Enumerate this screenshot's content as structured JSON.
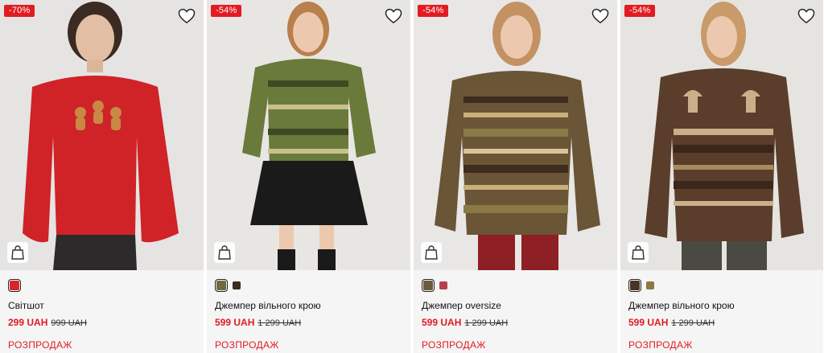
{
  "products": [
    {
      "badge": "-70%",
      "name": "Світшот",
      "price": "299 UAH",
      "old_price": "999 UAH",
      "label": "РОЗПРОДАЖ",
      "colors": [
        "#d8262d"
      ],
      "theme": {
        "bg": "#e6e4e2",
        "garment": "#cf2328",
        "garment_dark": "#a8181d",
        "hair": "#3b2b22",
        "pants": "#2c2a2b"
      }
    },
    {
      "badge": "-54%",
      "name": "Джемпер вільного крою",
      "price": "599 UAH",
      "old_price": "1 299 UAH",
      "label": "РОЗПРОДАЖ",
      "colors": [
        "#6e6a3c",
        "#3b2b22"
      ],
      "theme": {
        "bg": "#e8e6e3",
        "garment": "#6a7a3a",
        "garment_dark": "#3f4a22",
        "hair": "#b97f4c",
        "pants": "#1a1a1a"
      }
    },
    {
      "badge": "-54%",
      "name": "Джемпер oversize",
      "price": "599 UAH",
      "old_price": "1 299 UAH",
      "label": "РОЗПРОДАЖ",
      "colors": [
        "#6b5a3c",
        "#b9404a"
      ],
      "theme": {
        "bg": "#e9e7e5",
        "garment": "#6b5537",
        "garment_dark": "#3e2c1d",
        "hair": "#c49262",
        "pants": "#8e1f24"
      }
    },
    {
      "badge": "-54%",
      "name": "Джемпер вільного крою",
      "price": "599 UAH",
      "old_price": "1 299 UAH",
      "label": "РОЗПРОДАЖ",
      "colors": [
        "#4a3324",
        "#8a7a45"
      ],
      "theme": {
        "bg": "#e6e4e1",
        "garment": "#5a3d2b",
        "garment_dark": "#3a261a",
        "hair": "#c99a6a",
        "pants": "#4b4a42"
      }
    }
  ]
}
